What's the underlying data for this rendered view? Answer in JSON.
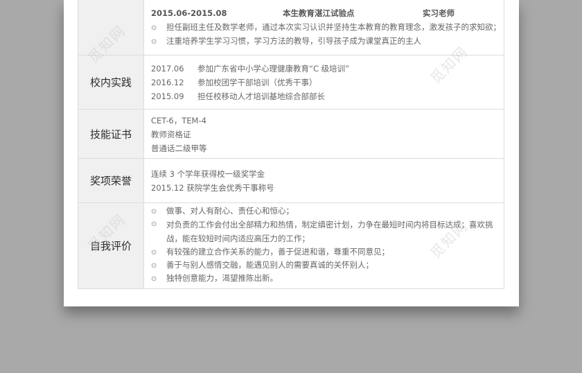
{
  "work": {
    "period": "2015.06-2015.08",
    "company": "本生教育湛江试验点",
    "position": "实习老师",
    "items": [
      "担任副班主任及数学老师，通过本次实习认识并坚持生本教育的教育理念，激发孩子的求知欲；",
      "注重培养学生学习习惯，学习方法的教导，引导孩子成为课堂真正的主人"
    ]
  },
  "practice": {
    "label": "校内实践",
    "entries": [
      {
        "date": "2017.06",
        "text": "参加广东省中小学心理健康教育“C 级培训”"
      },
      {
        "date": "2016.12",
        "text": "参加校团学干部培训（优秀干事）"
      },
      {
        "date": "2015.09",
        "text": "担任校移动人才培训基地综合部部长"
      }
    ]
  },
  "skills": {
    "label": "技能证书",
    "items": [
      "CET-6，TEM-4",
      "教师资格证",
      "普通话二级甲等"
    ]
  },
  "awards": {
    "label": "奖项荣誉",
    "items": [
      "连续 3 个学年获得校一级奖学金",
      "2015.12 获院学生会优秀干事称号"
    ]
  },
  "self_eval": {
    "label": "自我评价",
    "items": [
      "做事、对人有耐心、责任心和恒心；",
      "对负责的工作会付出全部精力和热情，制定缜密计划，力争在最短时间内将目标达成；喜欢挑战，能在较短时间内适应高压力的工作；",
      "有较强的建立合作关系的能力，善于促进和谐，尊重不同意见；",
      "善于与别人感情交融，能遇见别人的需要真诚的关怀别人；",
      "独特创意能力，渴望推陈出新。"
    ]
  },
  "bullet_icon": "circle-dot-icon",
  "watermark": "觅知网"
}
